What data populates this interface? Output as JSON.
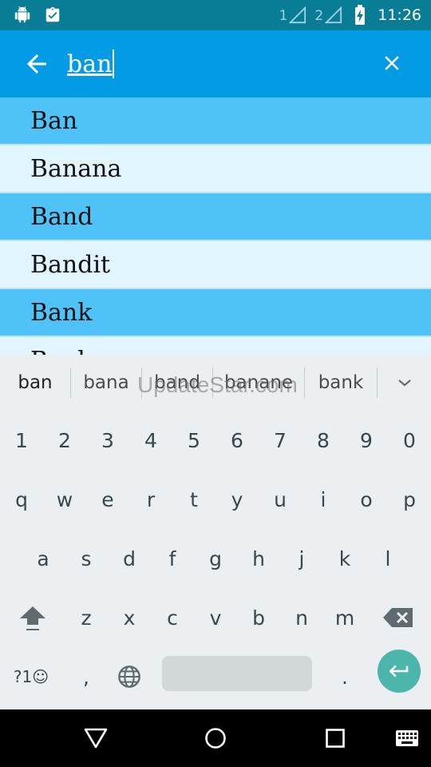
{
  "status_bar": {
    "time": "11:26",
    "sim1": "1",
    "sim2": "2",
    "icons": [
      "android-icon",
      "clipboard-check-icon",
      "signal-icon",
      "battery-charging-icon"
    ]
  },
  "search": {
    "query": "ban"
  },
  "results": [
    {
      "label": "Ban",
      "tone": "dark"
    },
    {
      "label": "Banana",
      "tone": "light"
    },
    {
      "label": "Band",
      "tone": "dark"
    },
    {
      "label": "Bandit",
      "tone": "light"
    },
    {
      "label": "Bank",
      "tone": "dark"
    },
    {
      "label": "Banker",
      "tone": "light"
    }
  ],
  "keyboard": {
    "suggestions": [
      "ban",
      "bana",
      "band",
      "banane",
      "bank"
    ],
    "number_row": [
      "1",
      "2",
      "3",
      "4",
      "5",
      "6",
      "7",
      "8",
      "9",
      "0"
    ],
    "row1": [
      "q",
      "w",
      "e",
      "r",
      "t",
      "y",
      "u",
      "i",
      "o",
      "p"
    ],
    "row2": [
      "a",
      "s",
      "d",
      "f",
      "g",
      "h",
      "j",
      "k",
      "l"
    ],
    "row3": [
      "z",
      "x",
      "c",
      "v",
      "b",
      "n",
      "m"
    ],
    "symbols_label": "?1☺",
    "comma": ",",
    "period": "."
  },
  "watermark": "UpdateStar.com",
  "colors": {
    "status_bar": "#0a7d96",
    "app_bar": "#039be5",
    "row_dark": "#4fc3f7",
    "row_light": "#e1f5fe",
    "keyboard_bg": "#eceff1",
    "enter_key": "#4db6ac"
  }
}
